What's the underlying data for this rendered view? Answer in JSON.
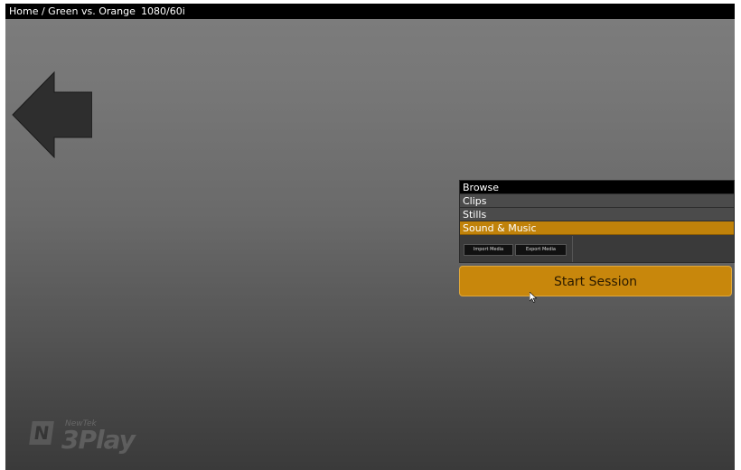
{
  "topbar": {
    "breadcrumb": "Home / Green vs. Orange",
    "video_format": "1080/60i"
  },
  "navigation": {
    "back_icon": "back-arrow-icon"
  },
  "menu": {
    "items": [
      {
        "label": "Browse"
      },
      {
        "label": "Clips"
      },
      {
        "label": "Stills"
      },
      {
        "label": "Sound & Music",
        "selected": true
      }
    ],
    "import_media_label": "Import Media",
    "export_media_label": "Export Media"
  },
  "start_session": {
    "label": "Start Session"
  },
  "branding": {
    "logo_badge": "N",
    "company": "NewTek",
    "product": "3Play"
  },
  "colors": {
    "accent": "#c8870c",
    "selected_item": "#c0820a",
    "topbar": "#000000"
  }
}
